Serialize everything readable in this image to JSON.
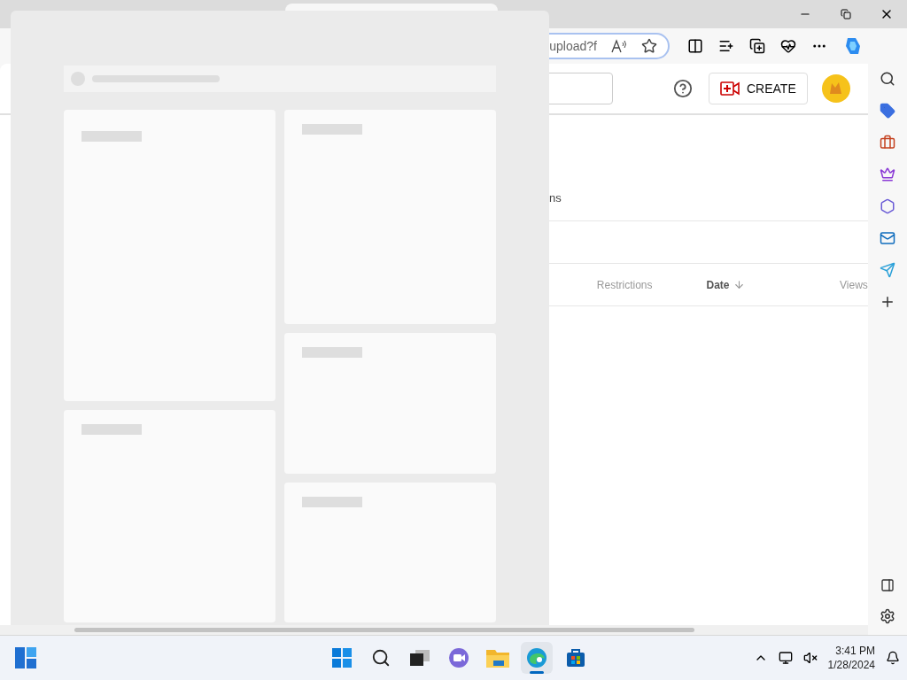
{
  "browser": {
    "address": "upload?f"
  },
  "studio_header": {
    "create_button": "CREATE"
  },
  "page": {
    "tab_fragment": "ns"
  },
  "table": {
    "columns": [
      {
        "label": "Restrictions",
        "sorted": false
      },
      {
        "label": "Date",
        "sorted": true
      },
      {
        "label": "Views",
        "sorted": false
      }
    ]
  },
  "taskbar": {
    "apps": [
      {
        "kind": "start",
        "selected": false
      },
      {
        "kind": "search",
        "selected": false
      },
      {
        "kind": "task-view",
        "selected": false
      },
      {
        "kind": "chat",
        "selected": false
      },
      {
        "kind": "files",
        "selected": false
      },
      {
        "kind": "browser",
        "selected": true
      },
      {
        "kind": "store",
        "selected": false
      }
    ],
    "clock": {
      "time": "3:41 PM",
      "date": "1/28/2024"
    }
  }
}
